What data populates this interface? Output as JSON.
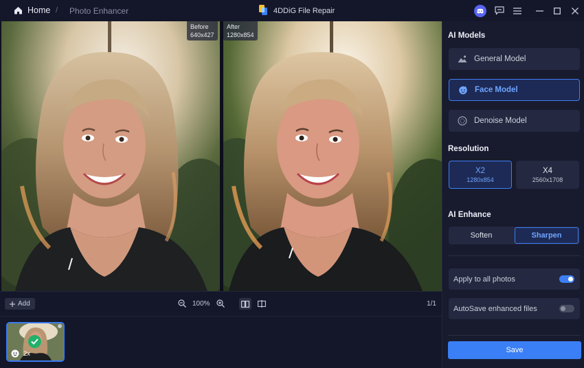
{
  "header": {
    "home_label": "Home",
    "breadcrumb_separator": "/",
    "breadcrumb_current": "Photo Enhancer",
    "app_title": "4DDiG File Repair",
    "icons": [
      "home-icon",
      "app-logo-icon",
      "discord-icon",
      "feedback-icon",
      "menu-icon",
      "minimize-icon",
      "maximize-icon",
      "close-icon"
    ]
  },
  "viewer": {
    "before_label": "Before",
    "before_size": "640x427",
    "after_label": "After",
    "after_size": "1280x854"
  },
  "viewbar": {
    "add_label": "Add",
    "zoom_level": "100%",
    "page_indicator": "1/1"
  },
  "thumbnail": {
    "scale_label": "2x",
    "status": "done"
  },
  "panel": {
    "ai_models_title": "AI Models",
    "models": [
      {
        "label": "General Model",
        "icon": "landscape-icon",
        "selected": false
      },
      {
        "label": "Face Model",
        "icon": "face-icon",
        "selected": true
      },
      {
        "label": "Denoise Model",
        "icon": "denoise-icon",
        "selected": false
      }
    ],
    "resolution_title": "Resolution",
    "resolutions": [
      {
        "label": "X2",
        "size": "1280x854",
        "selected": true
      },
      {
        "label": "X4",
        "size": "2560x1708",
        "selected": false
      }
    ],
    "ai_enhance_title": "AI Enhance",
    "enhance_options": [
      {
        "label": "Soften",
        "selected": false
      },
      {
        "label": "Sharpen",
        "selected": true
      }
    ],
    "apply_all_label": "Apply to all photos",
    "apply_all_on": true,
    "autosave_label": "AutoSave enhanced files",
    "autosave_on": false,
    "save_label": "Save"
  },
  "colors": {
    "accent": "#3d7ff5",
    "background": "#14172a",
    "panel": "#181b2e",
    "success": "#22b06a"
  }
}
